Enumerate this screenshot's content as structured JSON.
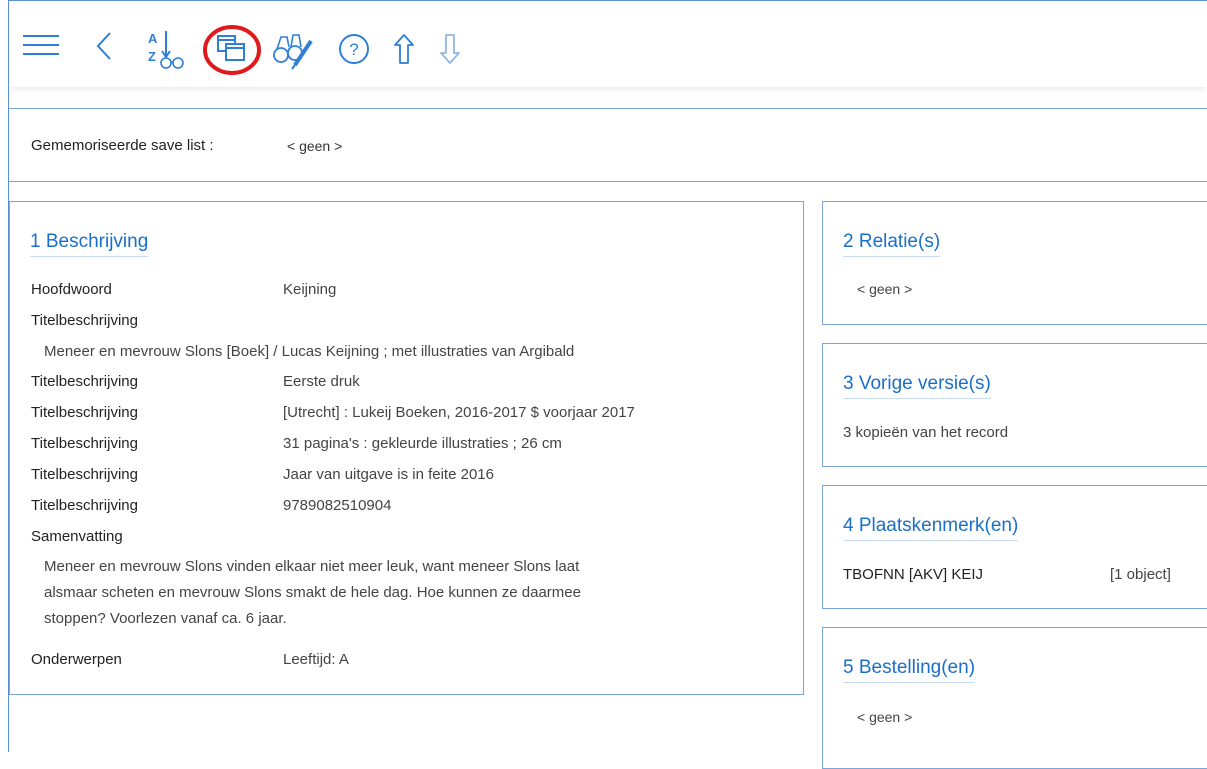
{
  "toolbar": {
    "buttons": [
      {
        "name": "menu-icon"
      },
      {
        "name": "back-icon"
      },
      {
        "name": "sort-az-icon"
      },
      {
        "name": "windows-icon"
      },
      {
        "name": "search-binoculars-icon"
      },
      {
        "name": "help-icon"
      },
      {
        "name": "arrow-up-icon"
      },
      {
        "name": "arrow-down-icon"
      }
    ],
    "highlight_color": "#e0191d"
  },
  "memo": {
    "label": "Gememoriseerde save list :",
    "value": "< geen >"
  },
  "beschrijving": {
    "title": "1  Beschrijving",
    "hoofdwoord_label": "Hoofdwoord",
    "hoofdwoord_value": "Keijning",
    "titel1_label": "Titelbeschrijving",
    "titel1_full": "Meneer en mevrouw Slons [Boek] / Lucas Keijning ; met illustraties van Argibald",
    "rows": [
      {
        "label": "Titelbeschrijving",
        "value": "Eerste druk"
      },
      {
        "label": "Titelbeschrijving",
        "value": "[Utrecht] : Lukeij Boeken, 2016-2017 $ voorjaar 2017"
      },
      {
        "label": "Titelbeschrijving",
        "value": "31 pagina's : gekleurde illustraties ; 26 cm"
      },
      {
        "label": "Titelbeschrijving",
        "value": "Jaar van uitgave is in feite 2016"
      },
      {
        "label": "Titelbeschrijving",
        "value": "9789082510904"
      }
    ],
    "samenvatting_label": "Samenvatting",
    "samenvatting_lines": [
      "Meneer en mevrouw Slons vinden elkaar niet meer leuk, want meneer Slons laat",
      "alsmaar scheten en mevrouw Slons smakt de hele dag. Hoe kunnen ze daarmee",
      "stoppen? Voorlezen vanaf ca. 6 jaar."
    ],
    "onderwerpen_label": "Onderwerpen",
    "onderwerpen_value": "Leeftijd: A"
  },
  "relaties": {
    "title": "2  Relatie(s)",
    "value": "< geen >"
  },
  "versies": {
    "title": "3  Vorige versie(s)",
    "value": "3 kopieën van het record"
  },
  "plaatskenmerk": {
    "title": "4  Plaatskenmerk(en)",
    "code": "TBOFNN [AKV] KEIJ",
    "count": "[1 object]"
  },
  "bestelling": {
    "title": "5  Bestelling(en)",
    "value": "< geen >"
  }
}
